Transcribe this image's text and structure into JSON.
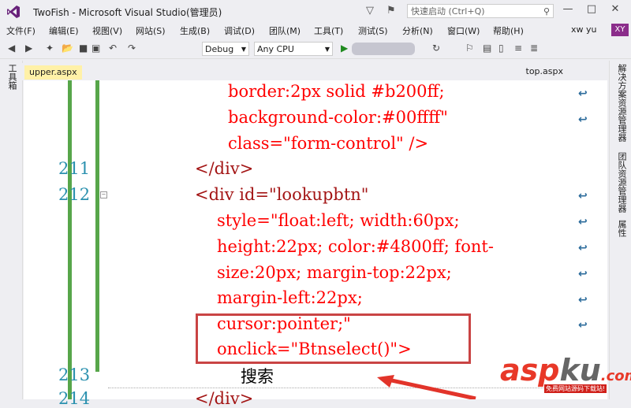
{
  "window": {
    "title": "TwoFish - Microsoft Visual Studio(管理员)",
    "quick_launch_placeholder": "快速启动 (Ctrl+Q)"
  },
  "menu": [
    "文件(F)",
    "编辑(E)",
    "视图(V)",
    "网站(S)",
    "生成(B)",
    "调试(D)",
    "团队(M)",
    "工具(T)",
    "测试(S)",
    "分析(N)",
    "窗口(W)",
    "帮助(H)"
  ],
  "user": {
    "name": "xw yu",
    "initials": "XY"
  },
  "toolbar": {
    "config": "Debug",
    "platform": "Any CPU"
  },
  "left_panel": {
    "label": "工具箱"
  },
  "right_panels": [
    "解决方案资源管理器",
    "团队资源管理器",
    "属性"
  ],
  "tabs": {
    "active": "upper.aspx",
    "other": "top.aspx"
  },
  "code": {
    "lines": [
      {
        "num": "",
        "text": "border:2px solid #b200ff;"
      },
      {
        "num": "",
        "text": "background-color:#00ffff\""
      },
      {
        "num": "",
        "text": "class=\"form-control\" />"
      },
      {
        "num": "211",
        "text": "</div>"
      },
      {
        "num": "212",
        "text": "<div id=\"lookupbtn\""
      },
      {
        "num": "",
        "text": "style=\"float:left; width:60px;"
      },
      {
        "num": "",
        "text": "height:22px; color:#4800ff; font-"
      },
      {
        "num": "",
        "text": "size:20px; margin-top:22px;"
      },
      {
        "num": "",
        "text": "margin-left:22px;"
      },
      {
        "num": "",
        "text": "cursor:pointer;\""
      },
      {
        "num": "",
        "text": "onclick=\"Btnselect()\">"
      },
      {
        "num": "213",
        "text": "搜索"
      },
      {
        "num": "214",
        "text": "</div>"
      }
    ]
  },
  "watermark": {
    "brand_a": "asp",
    "brand_b": "ku",
    "brand_c": ".com",
    "sub": "免费网站源码下载站!"
  }
}
